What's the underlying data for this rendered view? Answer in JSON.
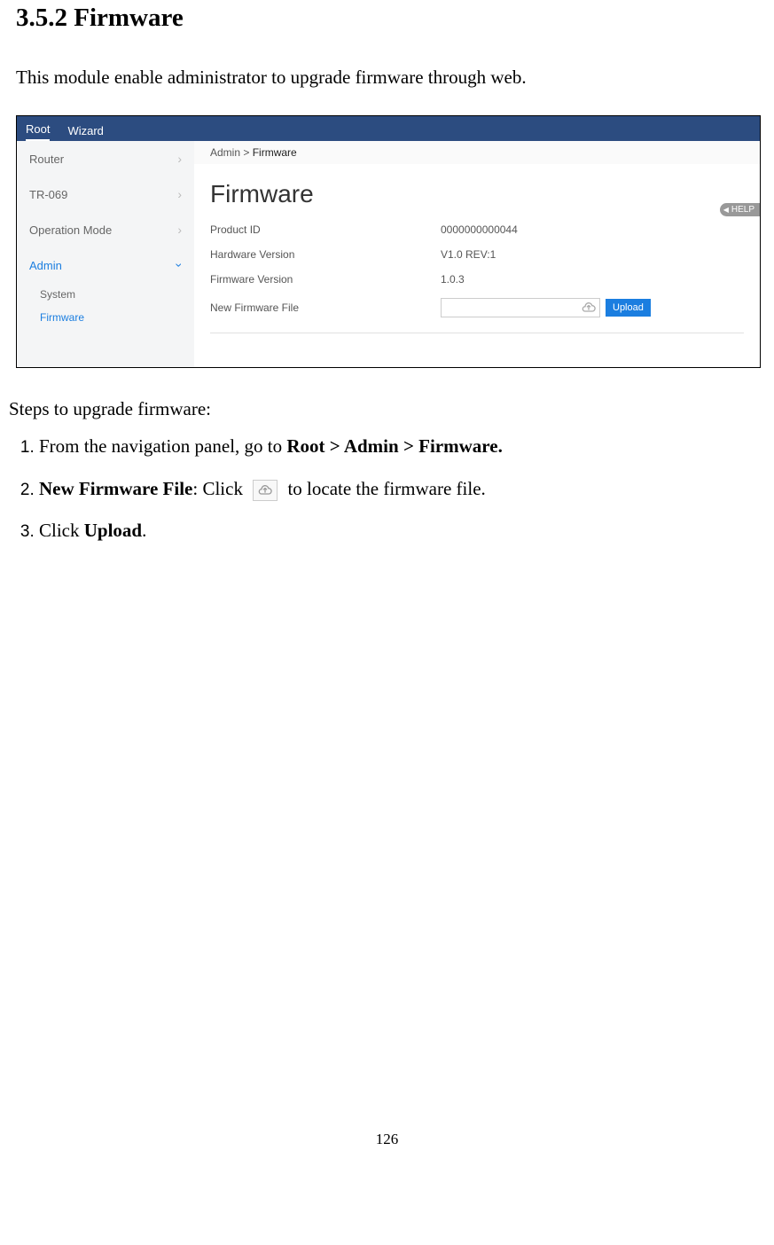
{
  "doc": {
    "section_number": "3.5.2 Firmware",
    "intro": "This module enable administrator to upgrade firmware through web.",
    "steps_heading": "Steps to upgrade firmware:",
    "step1_prefix": "From the navigation panel, go to ",
    "step1_bold": "Root > Admin > Firmware.",
    "step2_bold": "New Firmware File",
    "step2_mid": ": Click ",
    "step2_suffix": " to locate the firmware file.",
    "step3_prefix": "Click ",
    "step3_bold": "Upload",
    "step3_suffix": ".",
    "page_number": "126"
  },
  "ui": {
    "topbar": {
      "root": "Root",
      "wizard": "Wizard"
    },
    "sidebar": {
      "items": [
        {
          "label": "Router"
        },
        {
          "label": "TR-069"
        },
        {
          "label": "Operation Mode"
        },
        {
          "label": "Admin"
        }
      ],
      "sub": [
        {
          "label": "System"
        },
        {
          "label": "Firmware"
        }
      ]
    },
    "breadcrumb": {
      "parent": "Admin > ",
      "leaf": "Firmware"
    },
    "page_title": "Firmware",
    "help_label": "HELP",
    "rows": {
      "product_id_label": "Product ID",
      "product_id_value": "0000000000044",
      "hw_label": "Hardware Version",
      "hw_value": "V1.0 REV:1",
      "fw_label": "Firmware Version",
      "fw_value": "1.0.3",
      "newfile_label": "New Firmware File",
      "upload_btn": "Upload"
    }
  }
}
